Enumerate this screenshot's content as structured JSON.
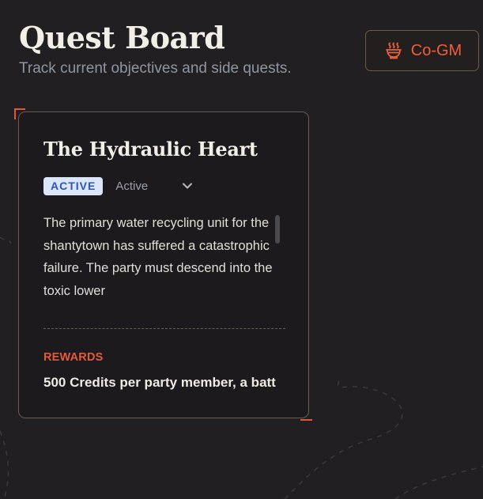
{
  "header": {
    "title": "Quest Board",
    "subtitle": "Track current objectives and side quests."
  },
  "cogm": {
    "label": "Co-GM",
    "icon": "bowl-steam-icon"
  },
  "quest": {
    "title": "The Hydraulic Heart",
    "status_badge": "ACTIVE",
    "status_select": "Active",
    "description": "The primary water recycling unit for the shantytown has suffered a catastrophic failure. The party must descend into the toxic lower",
    "rewards_label": "REWARDS",
    "rewards_text": "500 Credits per party member, a batt"
  },
  "colors": {
    "background": "#211f21",
    "accent": "#e7583a",
    "badge_bg": "#dbe6fb",
    "badge_text": "#2e55b8",
    "card_border": "#6a5d4c"
  }
}
